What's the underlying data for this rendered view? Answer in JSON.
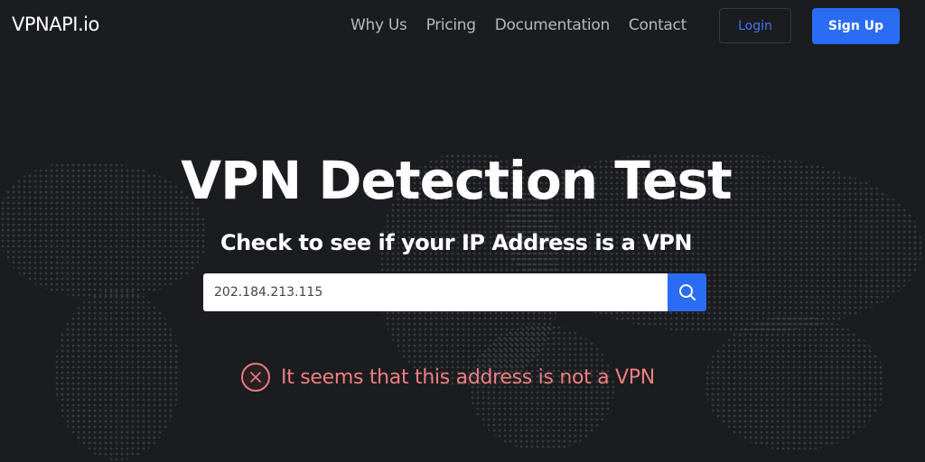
{
  "brand": {
    "name": "VPNAPI.io"
  },
  "nav": {
    "links": [
      "Why Us",
      "Pricing",
      "Documentation",
      "Contact"
    ],
    "login": "Login",
    "signup": "Sign Up"
  },
  "hero": {
    "title": "VPN Detection Test",
    "subtitle": "Check to see if your IP Address is a VPN"
  },
  "search": {
    "value": "202.184.213.115",
    "icon": "search-icon"
  },
  "result": {
    "icon": "x-circle-icon",
    "message": "It seems that this address is not a VPN",
    "color": "#ee7f7f"
  },
  "colors": {
    "background": "#1b1c20",
    "accent": "#2a6df4"
  }
}
